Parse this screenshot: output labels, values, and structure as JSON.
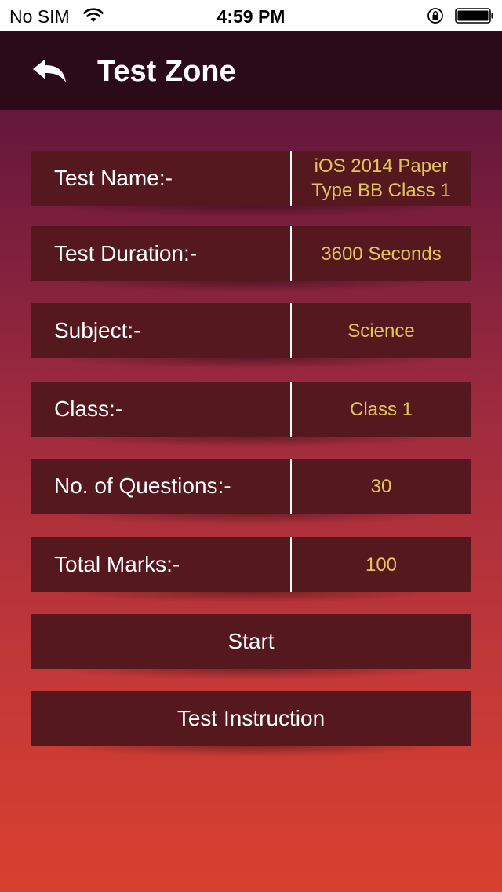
{
  "status_bar": {
    "carrier": "No SIM",
    "time": "4:59 PM",
    "wifi_icon": "wifi-icon",
    "lock_icon": "rotation-lock-icon",
    "battery_icon": "battery-icon"
  },
  "nav": {
    "back_icon": "back-arrow-icon",
    "title": "Test Zone"
  },
  "details": [
    {
      "label": "Test Name:-",
      "value": "iOS 2014 Paper Type BB Class 1"
    },
    {
      "label": "Test Duration:-",
      "value": "3600 Seconds"
    },
    {
      "label": "Subject:-",
      "value": "Science"
    },
    {
      "label": "Class:-",
      "value": "Class 1"
    },
    {
      "label": "No. of Questions:-",
      "value": "30"
    },
    {
      "label": "Total Marks:-",
      "value": "100"
    }
  ],
  "buttons": {
    "start": "Start",
    "instruction": "Test Instruction"
  },
  "colors": {
    "nav_background": "#2b0a1a",
    "row_background": "#55181e",
    "value_text": "#e6c45c",
    "gradient_top": "#4a1238",
    "gradient_bottom": "#d8402e"
  }
}
